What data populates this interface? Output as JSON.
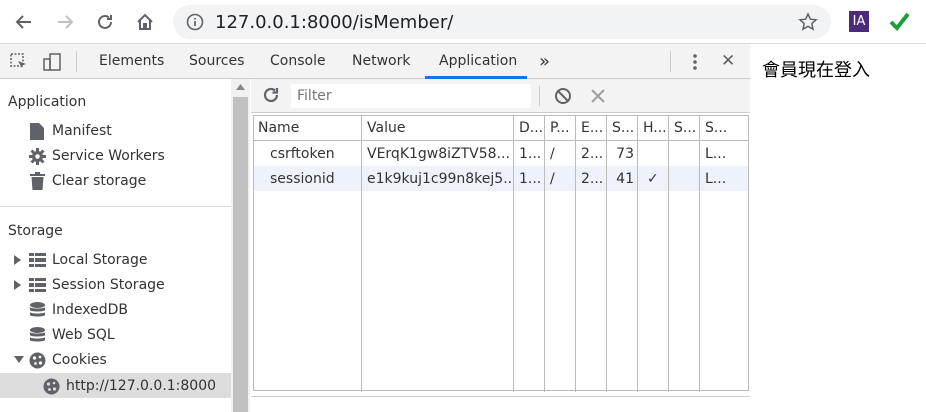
{
  "browser": {
    "url": "127.0.0.1:8000/isMember/",
    "extension_label": "IA"
  },
  "devtools": {
    "tabs": [
      "Elements",
      "Sources",
      "Console",
      "Network",
      "Application"
    ],
    "active_tab": "Application",
    "more_tabs": "»",
    "close": "✕"
  },
  "sidebar": {
    "application_title": "Application",
    "application_items": [
      "Manifest",
      "Service Workers",
      "Clear storage"
    ],
    "storage_title": "Storage",
    "storage_items": [
      "Local Storage",
      "Session Storage",
      "IndexedDB",
      "Web SQL",
      "Cookies"
    ],
    "cookie_origin": "http://127.0.0.1:8000"
  },
  "toolbar": {
    "filter_placeholder": "Filter"
  },
  "table": {
    "headers": [
      "Name",
      "Value",
      "D...",
      "P...",
      "E...",
      "S...",
      "H...",
      "S...",
      "S..."
    ],
    "rows": [
      {
        "name": "csrftoken",
        "value": "VErqK1gw8iZTV58...",
        "domain": "1...",
        "path": "/",
        "expires": "2...",
        "size": "73",
        "httponly": "",
        "secure": "",
        "samesite": "L..."
      },
      {
        "name": "sessionid",
        "value": "e1k9kuj1c99n8kej5...",
        "domain": "1...",
        "path": "/",
        "expires": "2...",
        "size": "41",
        "httponly": "✓",
        "secure": "",
        "samesite": "L..."
      }
    ]
  },
  "page": {
    "message": "會員現在登入"
  }
}
